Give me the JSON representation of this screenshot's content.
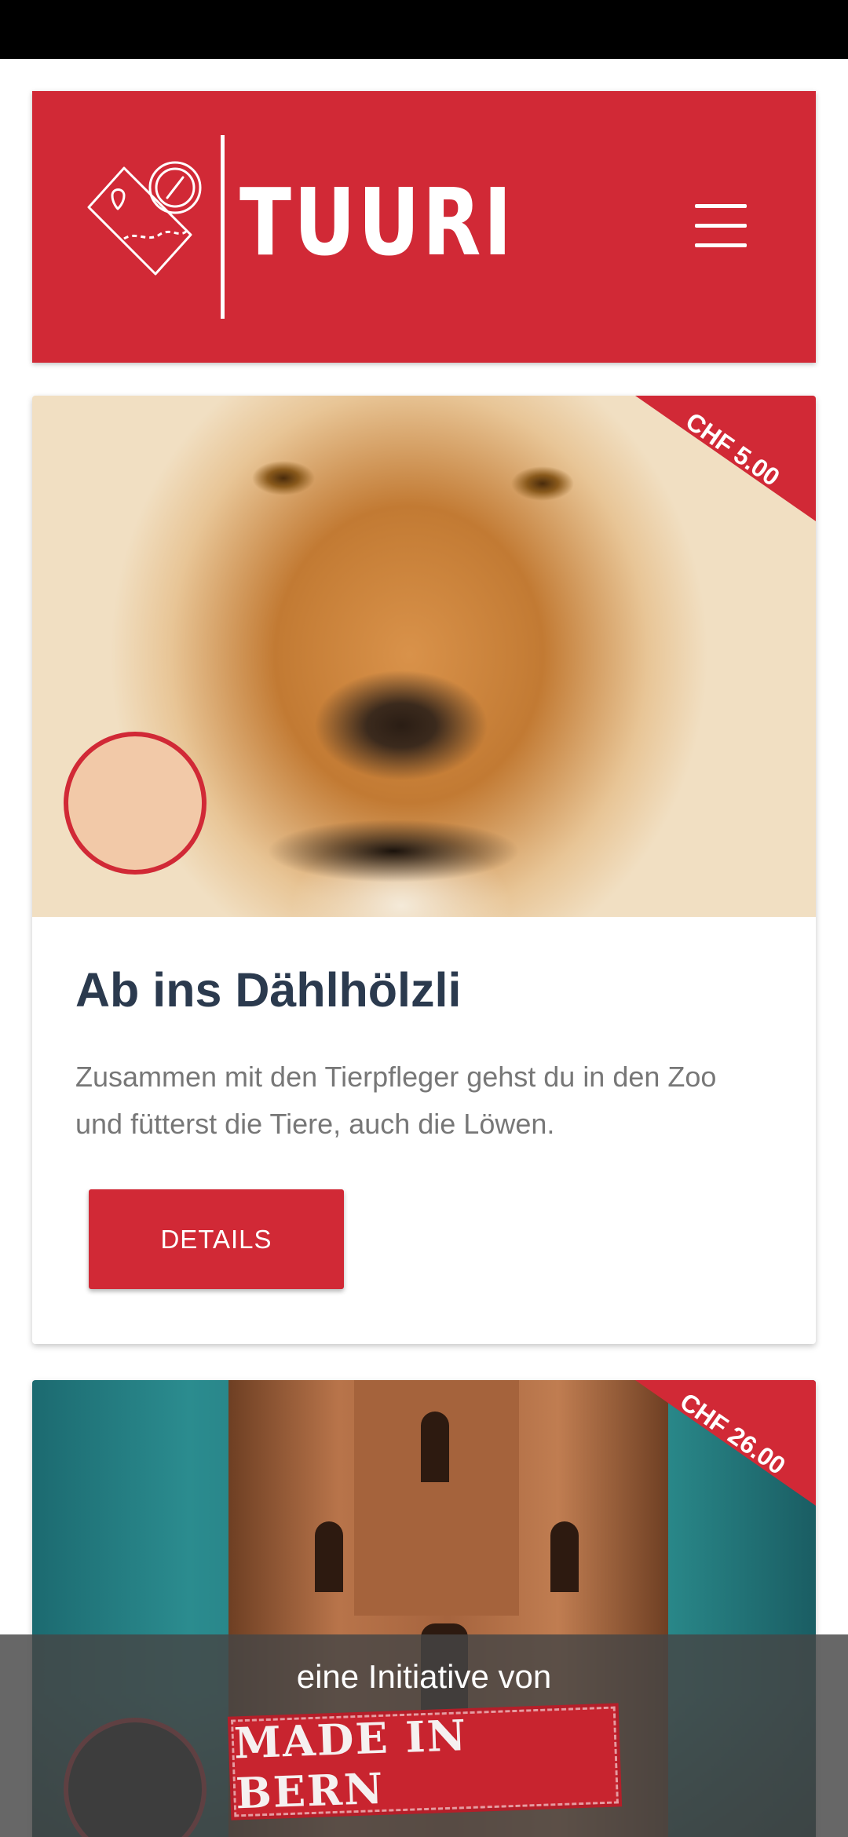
{
  "header": {
    "brand": "TUURI",
    "logo_icon": "map-compass-icon",
    "menu_icon": "hamburger-menu-icon"
  },
  "cards": [
    {
      "price": "CHF 5.00",
      "title": "Ab ins Dählhölzli",
      "description": "Zusammen mit den Tierpfleger gehst du in den Zoo und fütterst die Tiere, auch die Löwen.",
      "button": "DETAILS"
    },
    {
      "price": "CHF 26.00"
    }
  ],
  "footer": {
    "text": "eine Initiative von",
    "badge": "MADE IN BERN"
  },
  "colors": {
    "brand_red": "#d12936",
    "title": "#2b3a4e",
    "body_text": "#777777"
  }
}
